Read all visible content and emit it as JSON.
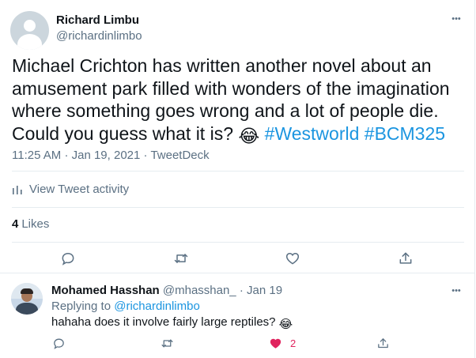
{
  "tweet": {
    "author_name": "Richard Limbu",
    "author_handle": "@richardinlimbo",
    "more_icon": "more-horizontal-icon",
    "text": "Michael Crichton has written another novel about an amusement park filled with wonders of the imagination where something goes wrong and a lot of people die. Could you guess what it is?",
    "emoji": "😂",
    "hashtags": [
      "#Westworld",
      "#BCM325"
    ],
    "time": "11:25 AM",
    "date": "Jan 19, 2021",
    "source": "TweetDeck",
    "meta_separator": "·",
    "activity_label": "View Tweet activity",
    "activity_icon": "bar-chart-icon",
    "likes_count": "4",
    "likes_label": "Likes",
    "actions": [
      "reply-icon",
      "retweet-icon",
      "like-icon",
      "share-icon"
    ]
  },
  "reply": {
    "author_name": "Mohamed Hasshan",
    "author_handle": "@mhasshan_",
    "separator": "·",
    "date": "Jan 19",
    "replying_to_label": "Replying to",
    "replying_to_handle": "@richardinlimbo",
    "text": "hahaha does it involve fairly large reptiles?",
    "emoji": "😂",
    "like_count": "2",
    "liked": true,
    "actions": [
      "reply-icon",
      "retweet-icon",
      "like-icon",
      "share-icon"
    ]
  },
  "colors": {
    "text": "#0f1419",
    "secondary": "#5b7083",
    "link": "#1b95e0",
    "like_active": "#e0245e",
    "divider": "#e6ecf0"
  }
}
